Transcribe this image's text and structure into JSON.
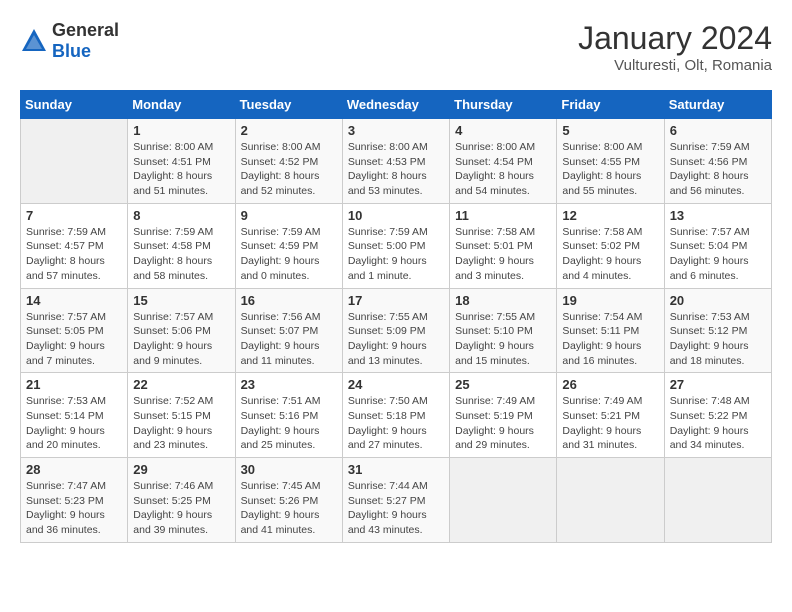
{
  "header": {
    "logo": {
      "text_general": "General",
      "text_blue": "Blue"
    },
    "month_title": "January 2024",
    "location": "Vulturesti, Olt, Romania"
  },
  "days_of_week": [
    "Sunday",
    "Monday",
    "Tuesday",
    "Wednesday",
    "Thursday",
    "Friday",
    "Saturday"
  ],
  "weeks": [
    [
      {
        "day": "",
        "info": ""
      },
      {
        "day": "1",
        "info": "Sunrise: 8:00 AM\nSunset: 4:51 PM\nDaylight: 8 hours\nand 51 minutes."
      },
      {
        "day": "2",
        "info": "Sunrise: 8:00 AM\nSunset: 4:52 PM\nDaylight: 8 hours\nand 52 minutes."
      },
      {
        "day": "3",
        "info": "Sunrise: 8:00 AM\nSunset: 4:53 PM\nDaylight: 8 hours\nand 53 minutes."
      },
      {
        "day": "4",
        "info": "Sunrise: 8:00 AM\nSunset: 4:54 PM\nDaylight: 8 hours\nand 54 minutes."
      },
      {
        "day": "5",
        "info": "Sunrise: 8:00 AM\nSunset: 4:55 PM\nDaylight: 8 hours\nand 55 minutes."
      },
      {
        "day": "6",
        "info": "Sunrise: 7:59 AM\nSunset: 4:56 PM\nDaylight: 8 hours\nand 56 minutes."
      }
    ],
    [
      {
        "day": "7",
        "info": "Sunrise: 7:59 AM\nSunset: 4:57 PM\nDaylight: 8 hours\nand 57 minutes."
      },
      {
        "day": "8",
        "info": "Sunrise: 7:59 AM\nSunset: 4:58 PM\nDaylight: 8 hours\nand 58 minutes."
      },
      {
        "day": "9",
        "info": "Sunrise: 7:59 AM\nSunset: 4:59 PM\nDaylight: 9 hours\nand 0 minutes."
      },
      {
        "day": "10",
        "info": "Sunrise: 7:59 AM\nSunset: 5:00 PM\nDaylight: 9 hours\nand 1 minute."
      },
      {
        "day": "11",
        "info": "Sunrise: 7:58 AM\nSunset: 5:01 PM\nDaylight: 9 hours\nand 3 minutes."
      },
      {
        "day": "12",
        "info": "Sunrise: 7:58 AM\nSunset: 5:02 PM\nDaylight: 9 hours\nand 4 minutes."
      },
      {
        "day": "13",
        "info": "Sunrise: 7:57 AM\nSunset: 5:04 PM\nDaylight: 9 hours\nand 6 minutes."
      }
    ],
    [
      {
        "day": "14",
        "info": "Sunrise: 7:57 AM\nSunset: 5:05 PM\nDaylight: 9 hours\nand 7 minutes."
      },
      {
        "day": "15",
        "info": "Sunrise: 7:57 AM\nSunset: 5:06 PM\nDaylight: 9 hours\nand 9 minutes."
      },
      {
        "day": "16",
        "info": "Sunrise: 7:56 AM\nSunset: 5:07 PM\nDaylight: 9 hours\nand 11 minutes."
      },
      {
        "day": "17",
        "info": "Sunrise: 7:55 AM\nSunset: 5:09 PM\nDaylight: 9 hours\nand 13 minutes."
      },
      {
        "day": "18",
        "info": "Sunrise: 7:55 AM\nSunset: 5:10 PM\nDaylight: 9 hours\nand 15 minutes."
      },
      {
        "day": "19",
        "info": "Sunrise: 7:54 AM\nSunset: 5:11 PM\nDaylight: 9 hours\nand 16 minutes."
      },
      {
        "day": "20",
        "info": "Sunrise: 7:53 AM\nSunset: 5:12 PM\nDaylight: 9 hours\nand 18 minutes."
      }
    ],
    [
      {
        "day": "21",
        "info": "Sunrise: 7:53 AM\nSunset: 5:14 PM\nDaylight: 9 hours\nand 20 minutes."
      },
      {
        "day": "22",
        "info": "Sunrise: 7:52 AM\nSunset: 5:15 PM\nDaylight: 9 hours\nand 23 minutes."
      },
      {
        "day": "23",
        "info": "Sunrise: 7:51 AM\nSunset: 5:16 PM\nDaylight: 9 hours\nand 25 minutes."
      },
      {
        "day": "24",
        "info": "Sunrise: 7:50 AM\nSunset: 5:18 PM\nDaylight: 9 hours\nand 27 minutes."
      },
      {
        "day": "25",
        "info": "Sunrise: 7:49 AM\nSunset: 5:19 PM\nDaylight: 9 hours\nand 29 minutes."
      },
      {
        "day": "26",
        "info": "Sunrise: 7:49 AM\nSunset: 5:21 PM\nDaylight: 9 hours\nand 31 minutes."
      },
      {
        "day": "27",
        "info": "Sunrise: 7:48 AM\nSunset: 5:22 PM\nDaylight: 9 hours\nand 34 minutes."
      }
    ],
    [
      {
        "day": "28",
        "info": "Sunrise: 7:47 AM\nSunset: 5:23 PM\nDaylight: 9 hours\nand 36 minutes."
      },
      {
        "day": "29",
        "info": "Sunrise: 7:46 AM\nSunset: 5:25 PM\nDaylight: 9 hours\nand 39 minutes."
      },
      {
        "day": "30",
        "info": "Sunrise: 7:45 AM\nSunset: 5:26 PM\nDaylight: 9 hours\nand 41 minutes."
      },
      {
        "day": "31",
        "info": "Sunrise: 7:44 AM\nSunset: 5:27 PM\nDaylight: 9 hours\nand 43 minutes."
      },
      {
        "day": "",
        "info": ""
      },
      {
        "day": "",
        "info": ""
      },
      {
        "day": "",
        "info": ""
      }
    ]
  ]
}
